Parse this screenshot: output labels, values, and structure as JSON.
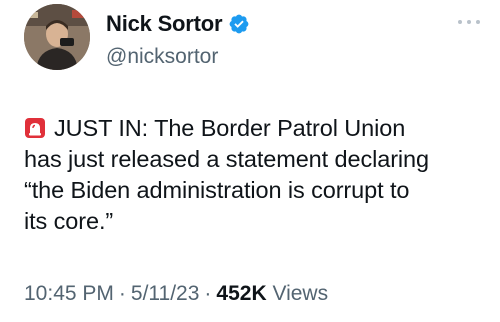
{
  "author": {
    "display_name": "Nick Sortor",
    "handle": "@nicksortor",
    "verified": true
  },
  "tweet": {
    "lines": [
      "JUST IN: The Border Patrol Union",
      "has just released a statement declaring",
      "“the Biden administration is corrupt to",
      "its core.”"
    ],
    "leading_emoji": "siren-icon"
  },
  "meta": {
    "time": "10:45 PM",
    "separator": "·",
    "date": "5/11/23",
    "views_count": "452K",
    "views_label": "Views"
  },
  "colors": {
    "text": "#0f1419",
    "secondary": "#536471",
    "verified_badge": "#1d9bf0",
    "siren": "#e0303a"
  }
}
